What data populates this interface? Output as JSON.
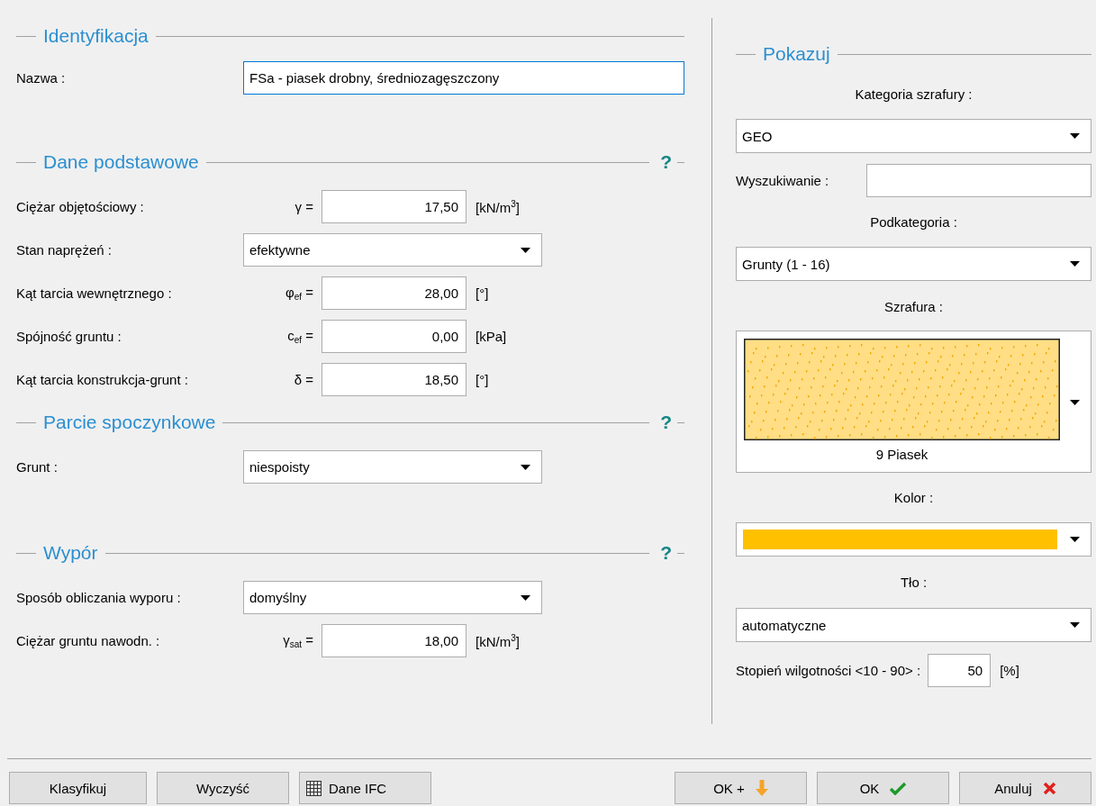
{
  "identification": {
    "title": "Identyfikacja",
    "name_field": {
      "label": "Nazwa :",
      "value": "FSa - piasek drobny, średniozagęszczony",
      "focused": true
    }
  },
  "sections": [
    {
      "title": "Dane podstawowe",
      "help": "?",
      "rows": [
        {
          "kind": "number",
          "label": "Ciężar objętościowy :",
          "symbol": "γ =",
          "value": "17,50",
          "unit": "[kN/m$^{3}$]"
        },
        {
          "kind": "select",
          "label": "Stan naprężeń :",
          "value": "efektywne"
        },
        {
          "kind": "number",
          "label": "Kąt tarcia wewnętrznego :",
          "symbol": "φ$_{ef}$ =",
          "value": "28,00",
          "unit": "[°]"
        },
        {
          "kind": "number",
          "label": "Spójność gruntu :",
          "symbol": "c$_{ef}$ =",
          "value": "0,00",
          "unit": "[kPa]"
        },
        {
          "kind": "number",
          "label": "Kąt tarcia konstrukcja-grunt :",
          "symbol": "δ =",
          "value": "18,50",
          "unit": "[°]"
        }
      ]
    },
    {
      "title": "Parcie spoczynkowe",
      "help": "?",
      "rows": [
        {
          "kind": "select",
          "label": "Grunt :",
          "value": "niespoisty"
        }
      ]
    },
    {
      "title": "Wypór",
      "help": "?",
      "rows": [
        {
          "kind": "select",
          "label": "Sposób obliczania wyporu :",
          "value": "domyślny"
        },
        {
          "kind": "number",
          "label": "Ciężar gruntu nawodn. :",
          "symbol": "γ$_{sat}$ =",
          "value": "18,00",
          "unit": "[kN/m$^{3}$]"
        }
      ]
    }
  ],
  "display": {
    "title": "Pokazuj",
    "hatch_category": {
      "label": "Kategoria szrafury :",
      "value": "GEO"
    },
    "search": {
      "label": "Wyszukiwanie :"
    },
    "subcategory": {
      "label": "Podkategoria :",
      "value": "Grunty (1 - 16)"
    },
    "hatch": {
      "label": "Szrafura :",
      "name": "9 Piasek"
    },
    "color": {
      "label": "Kolor :",
      "color": "#ffc000"
    },
    "background": {
      "label": "Tło :",
      "value": "automatyczne"
    },
    "moisture": {
      "label": "Stopień wilgotności <10 - 90> :",
      "value": "50",
      "unit": "[%]"
    }
  },
  "buttons_left": [
    {
      "label": "Klasyfikuj",
      "kind": "plain"
    },
    {
      "label": "Wyczyść",
      "kind": "plain"
    },
    {
      "label": "Dane IFC",
      "kind": "table"
    }
  ],
  "buttons_right": [
    {
      "label": "OK +",
      "kind": "add"
    },
    {
      "label": "OK",
      "kind": "ok"
    },
    {
      "label": "Anuluj",
      "kind": "cancel"
    }
  ]
}
